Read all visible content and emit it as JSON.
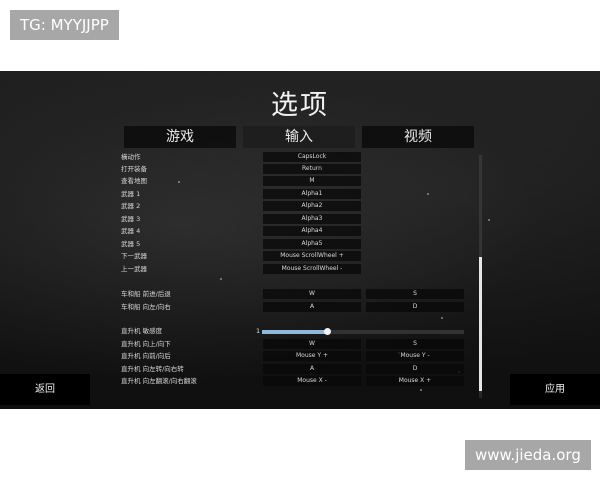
{
  "watermark_top": "TG: MYYJJPP",
  "watermark_bottom": "www.jieda.org",
  "title": "选项",
  "tabs": [
    "游戏",
    "输入",
    "视频"
  ],
  "rows": [
    {
      "label": "橫动作",
      "key1": "CapsLock"
    },
    {
      "label": "打开装备",
      "key1": "Return"
    },
    {
      "label": "查看地图",
      "key1": "M"
    },
    {
      "label": "武器 1",
      "key1": "Alpha1"
    },
    {
      "label": "武器 2",
      "key1": "Alpha2"
    },
    {
      "label": "武器 3",
      "key1": "Alpha3"
    },
    {
      "label": "武器 4",
      "key1": "Alpha4"
    },
    {
      "label": "武器 5",
      "key1": "Alpha5"
    },
    {
      "label": "下一武器",
      "key1": "Mouse ScrollWheel +"
    },
    {
      "label": "上一武器",
      "key1": "Mouse ScrollWheel -"
    },
    {
      "label": "车和船 前进/后退",
      "key1": "W",
      "key2": "S"
    },
    {
      "label": "车和船 向左/向右",
      "key1": "A",
      "key2": "D"
    },
    {
      "label": "直升机 敏感度",
      "slider": true,
      "value": "1",
      "level": 0.32
    },
    {
      "label": "直升机 向上/向下",
      "key1": "W",
      "key2": "S"
    },
    {
      "label": "直升机 向前/向后",
      "key1": "Mouse Y +",
      "key2": "Mouse Y -"
    },
    {
      "label": "直升机 向左转/向右转",
      "key1": "A",
      "key2": "D"
    },
    {
      "label": "直升机 向左翻滚/向右翻滚",
      "key1": "Mouse X -",
      "key2": "Mouse X +"
    }
  ],
  "scroll": {
    "start": 0.42,
    "end": 0.97
  },
  "back_label": "返回",
  "apply_label": "应用"
}
